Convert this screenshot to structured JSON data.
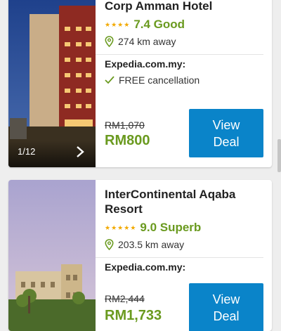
{
  "hotels": [
    {
      "name": "Corp Amman Hotel",
      "score": "7.4 Good",
      "star_count": 4,
      "distance": "274 km away",
      "provider": "Expedia.com.my:",
      "cancellation": "FREE cancellation",
      "old_price": "RM1,070",
      "price": "RM800",
      "photo_counter": "1/12",
      "deal_line1": "View",
      "deal_line2": "Deal"
    },
    {
      "name": "InterContinental Aqaba Resort",
      "score": "9.0 Superb",
      "star_count": 5,
      "distance": "203.5 km away",
      "provider": "Expedia.com.my:",
      "old_price": "RM2,444",
      "price": "RM1,733",
      "deal_line1": "View",
      "deal_line2": "Deal"
    }
  ],
  "colors": {
    "score_green": "#6a9a1f",
    "button_blue": "#0a84c9",
    "star_gold": "#f2a900"
  },
  "icons": [
    "location-pin-icon",
    "check-icon",
    "chevron-right-icon",
    "star-icon"
  ]
}
